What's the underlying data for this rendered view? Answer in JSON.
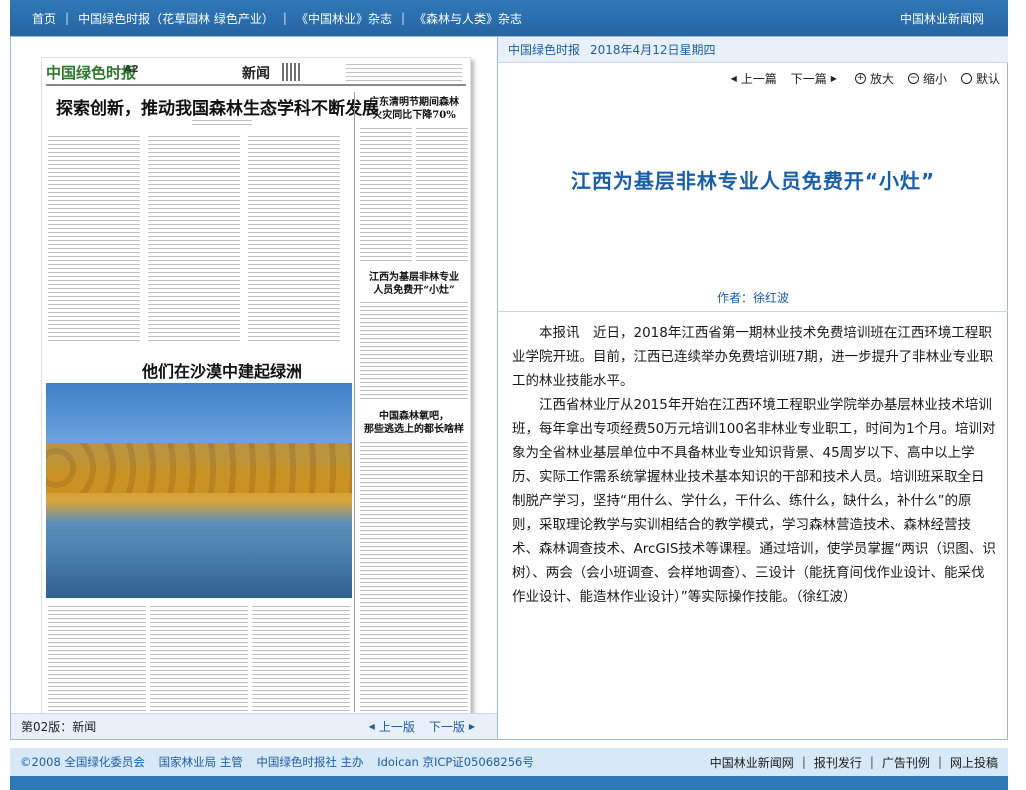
{
  "topnav": {
    "items": [
      "首页",
      "中国绿色时报（花草园林 绿色产业）",
      "《中国林业》杂志",
      "《森林与人类》杂志"
    ],
    "site": "中国林业新闻网"
  },
  "paper": {
    "masthead": "中国绿色时报",
    "page": "A2",
    "section": "新闻",
    "headline_main": "探索创新，推动我国森林生态学科不断发展",
    "headline_photo": "他们在沙漠中建起绿洲",
    "side_headline_1": "广东清明节期间森林\n火灾同比下降70%",
    "side_headline_2": "江西为基层非林专业\n人员免费开“小灶”",
    "side_headline_3": "中国森林氧吧，\n那些逃选上的都长啥样"
  },
  "leftbar": {
    "version": "第02版：新闻",
    "prev": "上一版",
    "next": "下一版"
  },
  "right": {
    "header_paper": "中国绿色时报",
    "header_date": "2018年4月12日星期四",
    "tools": {
      "prev": "上一篇",
      "next": "下一篇",
      "zoom_in": "放大",
      "zoom_out": "缩小",
      "default": "默认"
    },
    "title": "江西为基层非林专业人员免费开“小灶”",
    "author": "作者：徐红波",
    "paragraphs": [
      "本报讯　近日，2018年江西省第一期林业技术免费培训班在江西环境工程职业学院开班。目前，江西已连续举办免费培训班7期，进一步提升了非林业专业职工的林业技能水平。",
      "江西省林业厅从2015年开始在江西环境工程职业学院举办基层林业技术培训班，每年拿出专项经费50万元培训100名非林业专业职工，时间为1个月。培训对象为全省林业基层单位中不具备林业专业知识背景、45周岁以下、高中以上学历、实际工作需系统掌握林业技术基本知识的干部和技术人员。培训班采取全日制脱产学习，坚持“用什么、学什么，干什么、练什么，缺什么，补什么”的原则，采取理论教学与实训相结合的教学模式，学习森林营造技术、森林经营技术、森林调查技术、ArcGIS技术等课程。通过培训，使学员掌握“两识（识图、识树）、两会（会小班调查、会样地调查）、三设计（能抚育间伐作业设计、能采伐作业设计、能造林作业设计）”等实际操作技能。（徐红波）"
    ]
  },
  "footer": {
    "copyright": [
      "©2008 全国绿化委员会",
      "国家林业局 主管",
      "中国绿色时报社 主办",
      "Idoican 京ICP证05068256号"
    ],
    "links": [
      "中国林业新闻网",
      "报刊发行",
      "广告刊例",
      "网上投稿"
    ]
  }
}
